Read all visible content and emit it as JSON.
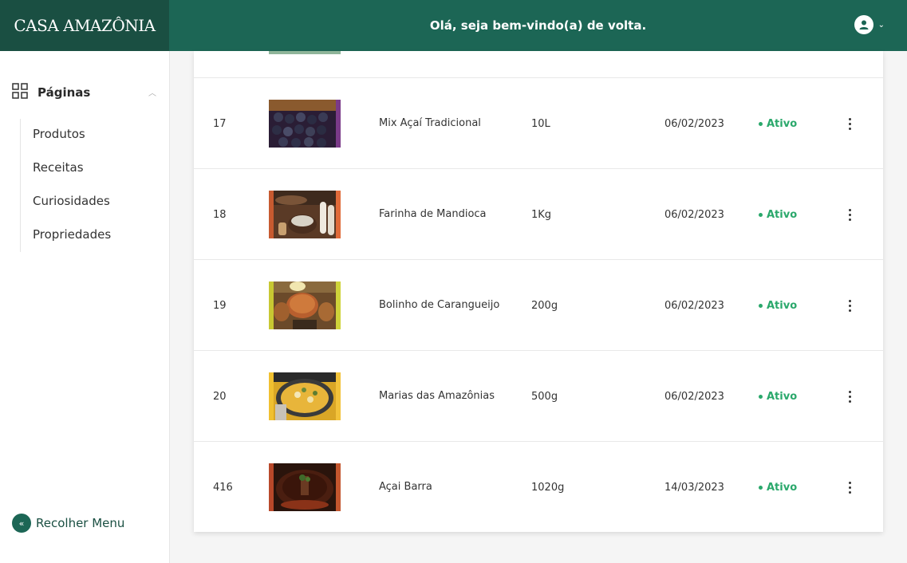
{
  "header": {
    "logo": "CASA AMAZÔNIA",
    "welcome": "Olá, seja bem-vindo(a) de volta."
  },
  "sidebar": {
    "section_label": "Páginas",
    "items": [
      {
        "label": "Produtos"
      },
      {
        "label": "Receitas"
      },
      {
        "label": "Curiosidades"
      },
      {
        "label": "Propriedades"
      }
    ],
    "collapse_label": "Recolher Menu"
  },
  "table": {
    "rows": [
      {
        "id": "17",
        "name": "Mix Açaí Tradicional",
        "quantity": "10L",
        "date": "06/02/2023",
        "status": "Ativo"
      },
      {
        "id": "18",
        "name": "Farinha de Mandioca",
        "quantity": "1Kg",
        "date": "06/02/2023",
        "status": "Ativo"
      },
      {
        "id": "19",
        "name": "Bolinho de Carangueijo",
        "quantity": "200g",
        "date": "06/02/2023",
        "status": "Ativo"
      },
      {
        "id": "20",
        "name": "Marias das Amazônias",
        "quantity": "500g",
        "date": "06/02/2023",
        "status": "Ativo"
      },
      {
        "id": "416",
        "name": "Açai Barra",
        "quantity": "1020g",
        "date": "14/03/2023",
        "status": "Ativo"
      }
    ]
  },
  "colors": {
    "header_bg": "#1c6655",
    "logo_bg": "#1a4f42",
    "status_active": "#2aa86b"
  }
}
